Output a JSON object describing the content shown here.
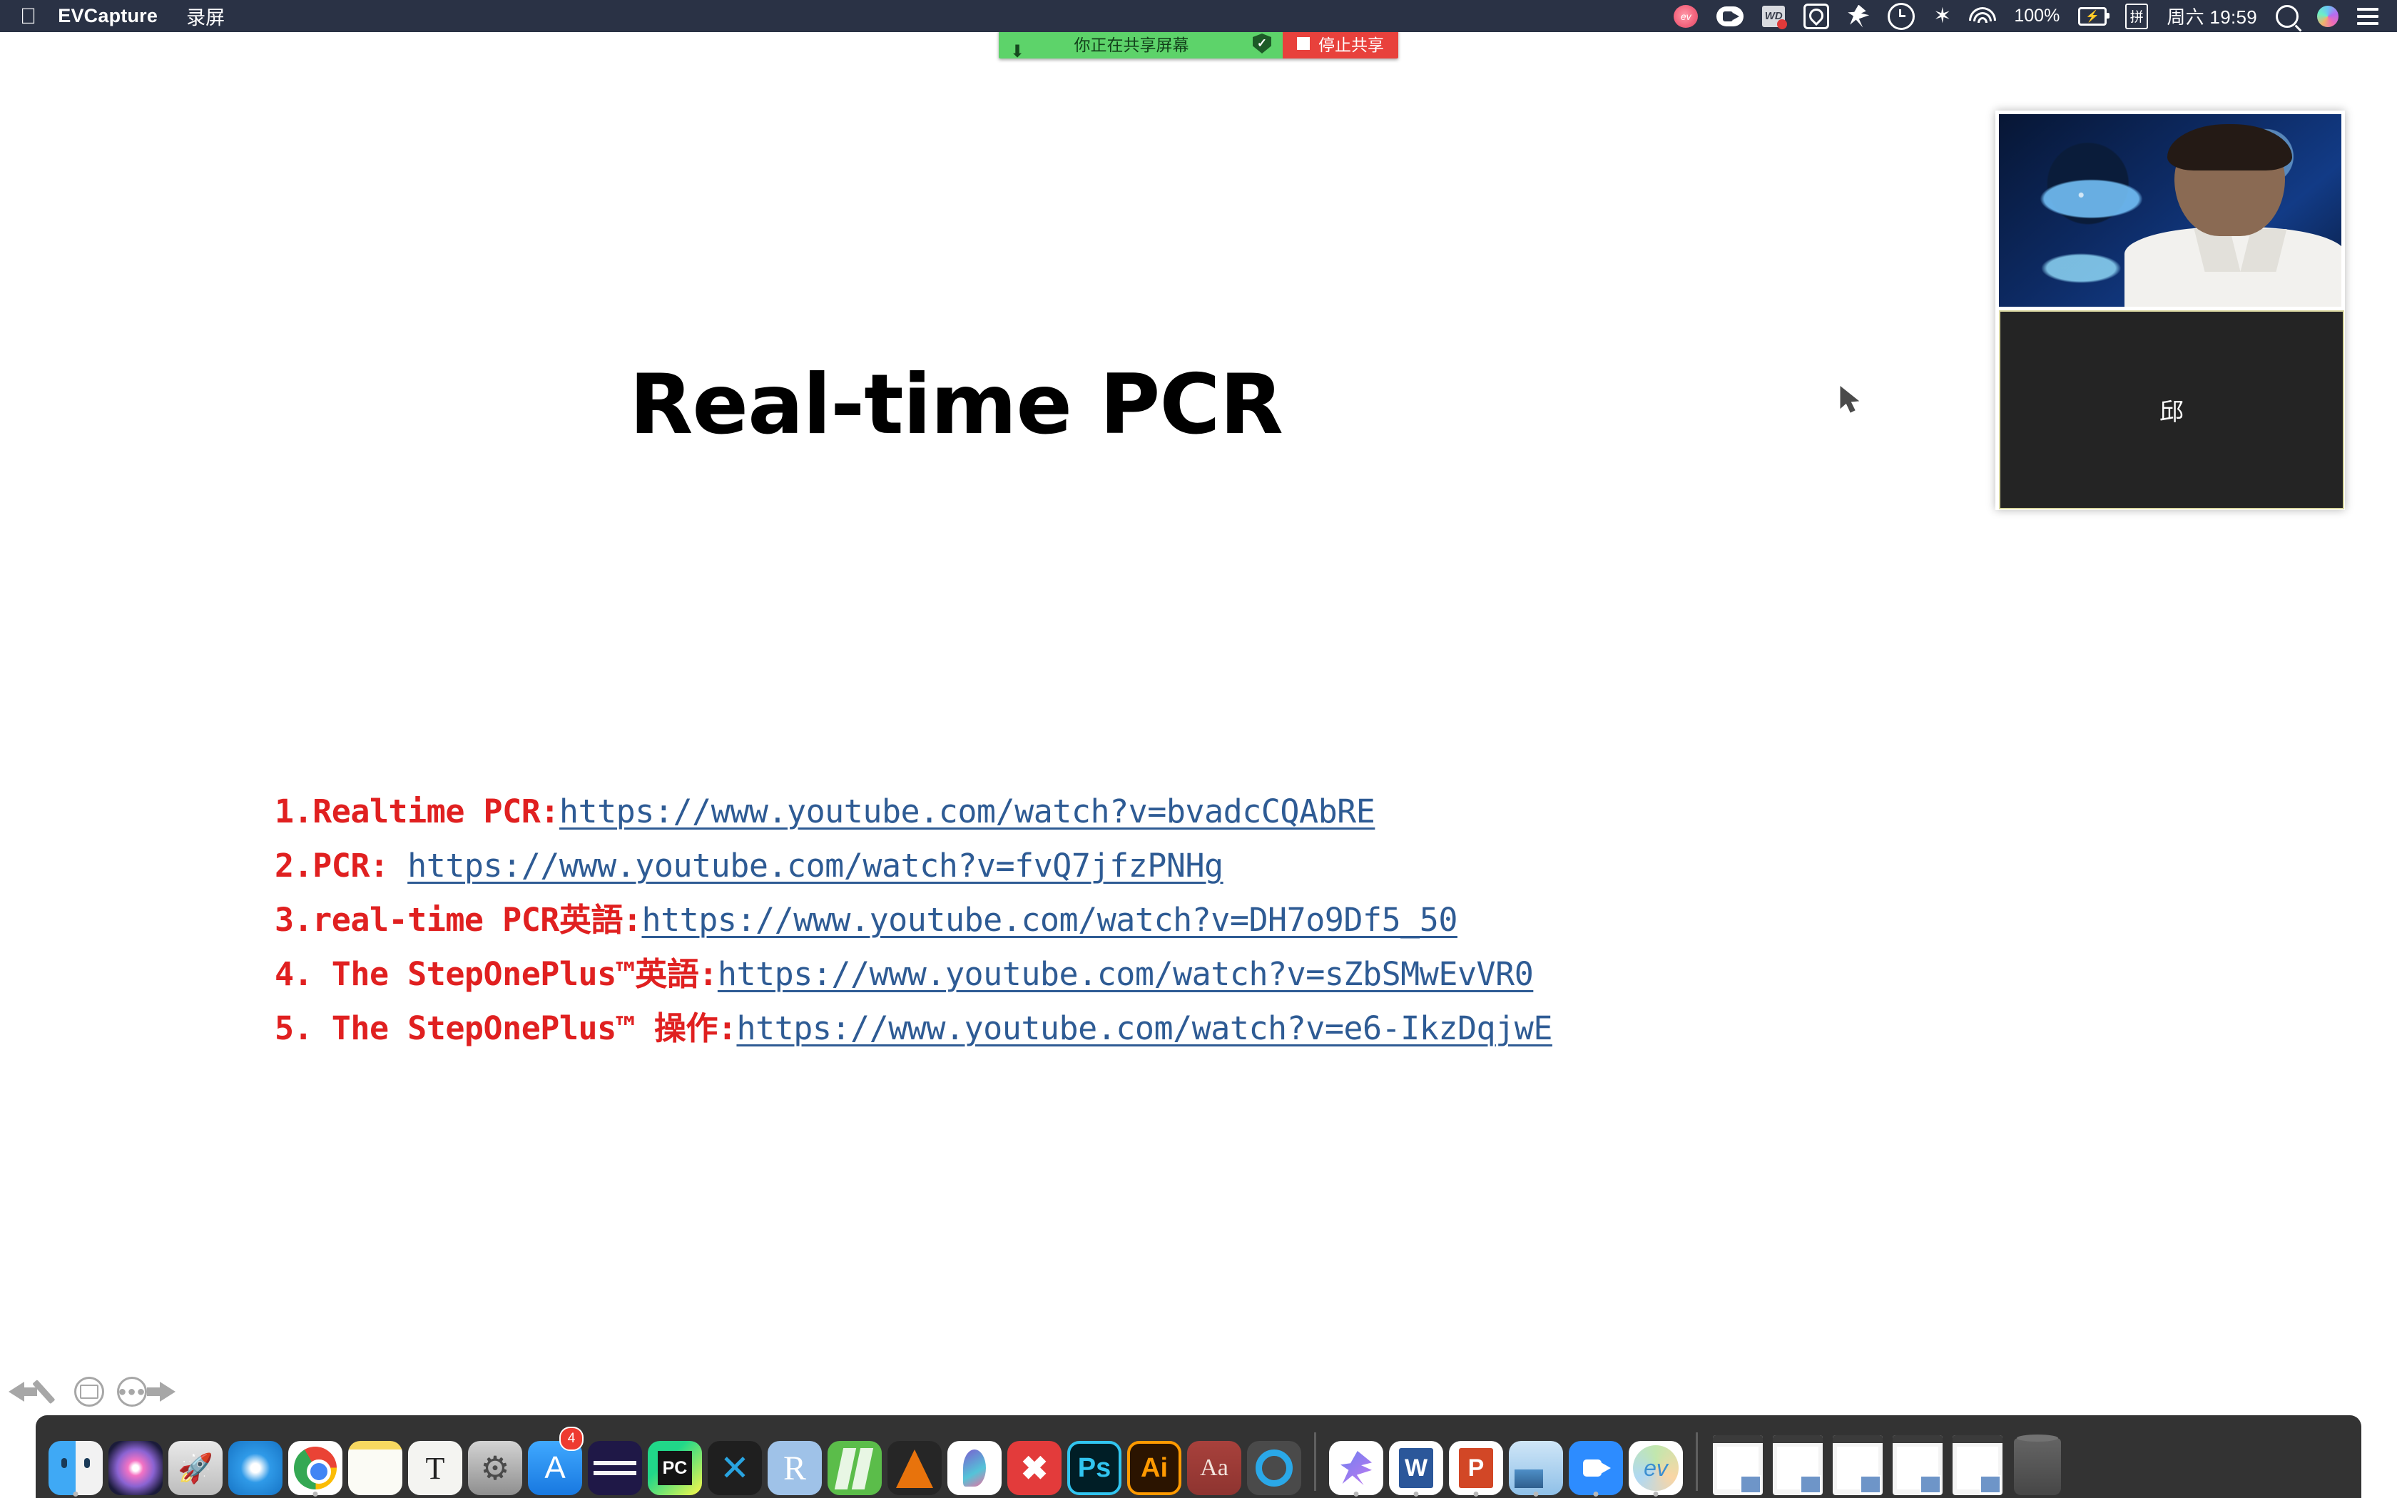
{
  "menubar": {
    "apple_logo": "",
    "app_name": "EVCapture",
    "menus": [
      "录屏"
    ],
    "battery_percent": "100%",
    "datetime": "周六 19:59",
    "status_icons": [
      "evcapture-icon",
      "zoom-camera-icon",
      "wps-icon",
      "creative-cloud-icon",
      "bird-icon",
      "time-machine-icon",
      "bluetooth-icon",
      "wifi-icon",
      "battery-icon",
      "input-method-icon",
      "spotlight-search-icon",
      "siri-icon",
      "control-center-icon"
    ]
  },
  "sharebar": {
    "status_label": "你正在共享屏幕",
    "stop_label": "停止共享",
    "shield_icon": "shield-check-icon",
    "arrow_icon": "download-arrow-icon"
  },
  "slide": {
    "title": "Real-time PCR",
    "links": [
      {
        "label": "1.Realtime PCR:",
        "url": "https://www.youtube.com/watch?v=bvadcCQAbRE"
      },
      {
        "label": "2.PCR: ",
        "url": "https://www.youtube.com/watch?v=fvQ7jfzPNHg"
      },
      {
        "label": "3.real-time PCR英語:",
        "url": "https://www.youtube.com/watch?v=DH7o9Df5_50"
      },
      {
        "label": "4. The StepOnePlus™英語:",
        "url": "https://www.youtube.com/watch?v=sZbSMwEvVR0"
      },
      {
        "label": "5. The StepOnePlus™ 操作:",
        "url": "https://www.youtube.com/watch?v=e6-IkzDqjwE"
      }
    ]
  },
  "video_panel": {
    "self_view_name": "",
    "participant_name": "邱"
  },
  "annotation_toolbar": {
    "items": [
      "back-arrow-icon",
      "pencil-icon",
      "keyboard-icon",
      "more-options-icon",
      "forward-arrow-icon"
    ]
  },
  "dock": {
    "items": [
      {
        "name": "finder",
        "label": "Finder",
        "class": "ic-finder",
        "glyph": "",
        "running": true
      },
      {
        "name": "siri",
        "label": "Siri",
        "class": "ic-siri",
        "glyph": "",
        "running": false
      },
      {
        "name": "launchpad",
        "label": "Launchpad",
        "class": "ic-launchpad",
        "glyph": "🚀",
        "running": false
      },
      {
        "name": "safari",
        "label": "Safari",
        "class": "ic-safari",
        "glyph": "",
        "running": false
      },
      {
        "name": "chrome",
        "label": "Google Chrome",
        "class": "ic-chrome",
        "glyph": "",
        "running": true
      },
      {
        "name": "notes",
        "label": "Notes",
        "class": "ic-notes",
        "glyph": "",
        "running": false
      },
      {
        "name": "textedit",
        "label": "TextEdit",
        "class": "ic-textedit",
        "glyph": "T",
        "running": false
      },
      {
        "name": "system-preferences",
        "label": "System Preferences",
        "class": "ic-syspref",
        "glyph": "⚙",
        "running": false
      },
      {
        "name": "app-store",
        "label": "App Store",
        "class": "ic-appstore",
        "glyph": "A",
        "badge": "4",
        "running": false
      },
      {
        "name": "anaconda",
        "label": "Anaconda Navigator",
        "class": "ic-anaconda",
        "glyph": "",
        "running": false
      },
      {
        "name": "pycharm",
        "label": "PyCharm",
        "class": "ic-pycharm",
        "glyph": "",
        "running": false
      },
      {
        "name": "vscode",
        "label": "Visual Studio Code",
        "class": "ic-vscode",
        "glyph": "✕",
        "running": false
      },
      {
        "name": "rstudio",
        "label": "RStudio",
        "class": "ic-rstudio",
        "glyph": "R",
        "running": false
      },
      {
        "name": "green-app",
        "label": "GoldenDict",
        "class": "ic-green",
        "glyph": "",
        "running": false
      },
      {
        "name": "vlc",
        "label": "VLC",
        "class": "ic-vlc",
        "glyph": "",
        "running": false
      },
      {
        "name": "typora",
        "label": "Typora",
        "class": "ic-typora",
        "glyph": "",
        "running": false
      },
      {
        "name": "xmind",
        "label": "XMind",
        "class": "ic-xmind",
        "glyph": "✖",
        "running": false
      },
      {
        "name": "photoshop",
        "label": "Adobe Photoshop",
        "class": "ic-ps",
        "glyph": "Ps",
        "running": false
      },
      {
        "name": "illustrator",
        "label": "Adobe Illustrator",
        "class": "ic-ai",
        "glyph": "Ai",
        "running": false
      },
      {
        "name": "dictionary",
        "label": "Dictionary",
        "class": "ic-dict",
        "glyph": "Aa",
        "running": false
      },
      {
        "name": "quicktime",
        "label": "QuickTime Player",
        "class": "ic-quicktime",
        "glyph": "",
        "running": false
      },
      {
        "name": "separator-1",
        "label": "",
        "class": "sep",
        "glyph": "",
        "running": false
      },
      {
        "name": "eudic",
        "label": "Eudic",
        "class": "ic-eudic",
        "glyph": "",
        "running": true
      },
      {
        "name": "word",
        "label": "Microsoft Word",
        "class": "ic-word",
        "glyph": "",
        "running": true
      },
      {
        "name": "powerpoint",
        "label": "Microsoft PowerPoint",
        "class": "ic-ppt",
        "glyph": "",
        "running": true
      },
      {
        "name": "preview",
        "label": "Preview",
        "class": "ic-preview",
        "glyph": "",
        "running": true
      },
      {
        "name": "zoom",
        "label": "zoom.us",
        "class": "ic-zoomapp",
        "glyph": "",
        "running": true
      },
      {
        "name": "evcapture",
        "label": "EVCapture",
        "class": "ic-evcap",
        "glyph": "",
        "running": true
      },
      {
        "name": "separator-2",
        "label": "",
        "class": "sep",
        "glyph": "",
        "running": false
      },
      {
        "name": "minimized-window-1",
        "label": "",
        "class": "mini",
        "glyph": "",
        "running": false
      },
      {
        "name": "minimized-window-2",
        "label": "",
        "class": "mini",
        "glyph": "",
        "running": false
      },
      {
        "name": "minimized-window-3",
        "label": "",
        "class": "mini",
        "glyph": "",
        "running": false
      },
      {
        "name": "minimized-window-4",
        "label": "",
        "class": "mini",
        "glyph": "",
        "running": false
      },
      {
        "name": "minimized-window-5",
        "label": "",
        "class": "mini",
        "glyph": "",
        "running": false
      },
      {
        "name": "trash",
        "label": "Trash",
        "class": "trashbin",
        "glyph": "",
        "running": false
      }
    ]
  },
  "colors": {
    "menubar_bg": "#2a3245",
    "share_green": "#5dd36a",
    "share_red": "#e8413c",
    "link_red": "#e02020",
    "link_blue": "#2e5b94"
  }
}
